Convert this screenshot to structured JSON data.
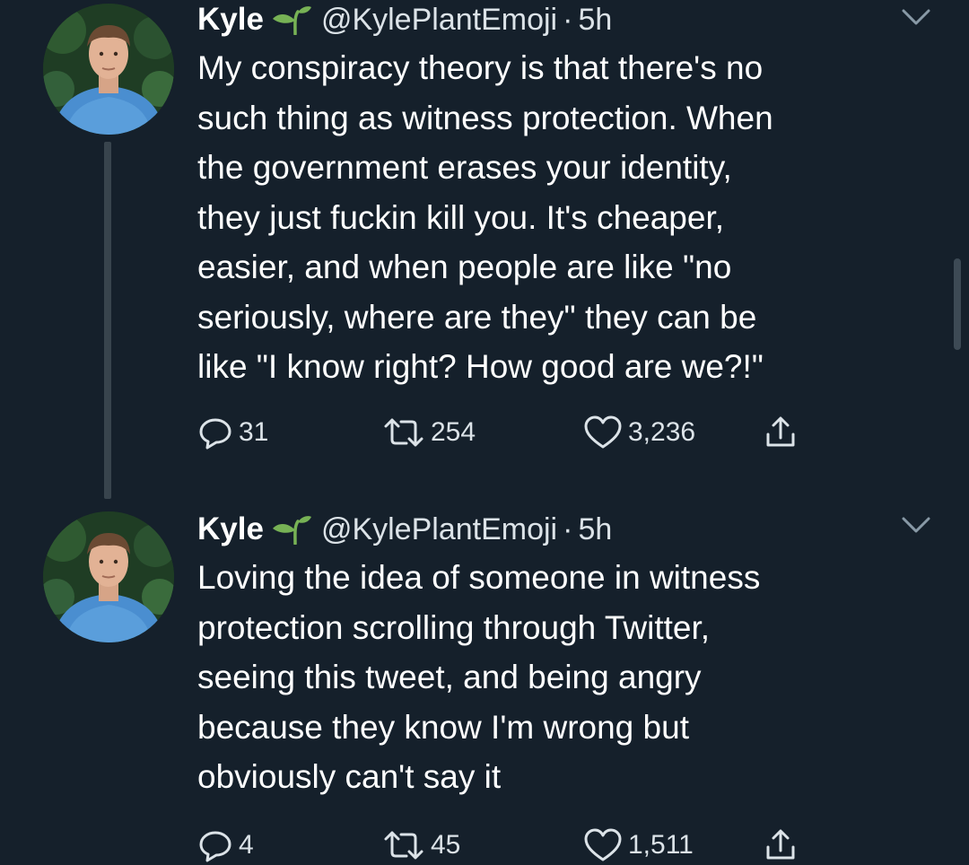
{
  "tweets": [
    {
      "author_name": "Kyle",
      "handle": "@KylePlantEmoji",
      "separator": "·",
      "time": "5h",
      "name_emoji": "seedling-icon",
      "text_lines": [
        "My conspiracy theory is that there's no",
        "such thing as witness protection. When",
        "the government erases your identity,",
        "they just fuckin kill you. It's cheaper,",
        "easier, and when people are like \"no",
        "seriously, where are they\" they can be",
        "like \"I know right? How good are we?!\""
      ],
      "replies": "31",
      "retweets": "254",
      "likes": "3,236"
    },
    {
      "author_name": "Kyle",
      "handle": "@KylePlantEmoji",
      "separator": "·",
      "time": "5h",
      "name_emoji": "seedling-icon",
      "text_lines": [
        "Loving the idea of someone in witness",
        "protection scrolling through Twitter,",
        "seeing this tweet, and being angry",
        "because they know I'm wrong but",
        "obviously can't say it"
      ],
      "replies": "4",
      "retweets": "45",
      "likes": "1,511"
    }
  ],
  "colors": {
    "background": "#15202b",
    "text": "#ffffff",
    "secondary_text": "#dce3e8",
    "icon": "#dce3e8",
    "thread_line": "#38444d",
    "seedling": "#77b255"
  }
}
